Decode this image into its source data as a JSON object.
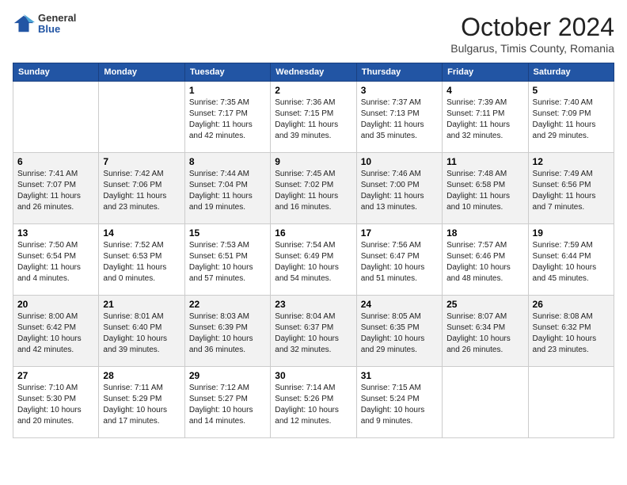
{
  "header": {
    "logo_general": "General",
    "logo_blue": "Blue",
    "month_title": "October 2024",
    "subtitle": "Bulgarus, Timis County, Romania"
  },
  "weekdays": [
    "Sunday",
    "Monday",
    "Tuesday",
    "Wednesday",
    "Thursday",
    "Friday",
    "Saturday"
  ],
  "weeks": [
    [
      {
        "day": "",
        "info": ""
      },
      {
        "day": "",
        "info": ""
      },
      {
        "day": "1",
        "info": "Sunrise: 7:35 AM\nSunset: 7:17 PM\nDaylight: 11 hours and 42 minutes."
      },
      {
        "day": "2",
        "info": "Sunrise: 7:36 AM\nSunset: 7:15 PM\nDaylight: 11 hours and 39 minutes."
      },
      {
        "day": "3",
        "info": "Sunrise: 7:37 AM\nSunset: 7:13 PM\nDaylight: 11 hours and 35 minutes."
      },
      {
        "day": "4",
        "info": "Sunrise: 7:39 AM\nSunset: 7:11 PM\nDaylight: 11 hours and 32 minutes."
      },
      {
        "day": "5",
        "info": "Sunrise: 7:40 AM\nSunset: 7:09 PM\nDaylight: 11 hours and 29 minutes."
      }
    ],
    [
      {
        "day": "6",
        "info": "Sunrise: 7:41 AM\nSunset: 7:07 PM\nDaylight: 11 hours and 26 minutes."
      },
      {
        "day": "7",
        "info": "Sunrise: 7:42 AM\nSunset: 7:06 PM\nDaylight: 11 hours and 23 minutes."
      },
      {
        "day": "8",
        "info": "Sunrise: 7:44 AM\nSunset: 7:04 PM\nDaylight: 11 hours and 19 minutes."
      },
      {
        "day": "9",
        "info": "Sunrise: 7:45 AM\nSunset: 7:02 PM\nDaylight: 11 hours and 16 minutes."
      },
      {
        "day": "10",
        "info": "Sunrise: 7:46 AM\nSunset: 7:00 PM\nDaylight: 11 hours and 13 minutes."
      },
      {
        "day": "11",
        "info": "Sunrise: 7:48 AM\nSunset: 6:58 PM\nDaylight: 11 hours and 10 minutes."
      },
      {
        "day": "12",
        "info": "Sunrise: 7:49 AM\nSunset: 6:56 PM\nDaylight: 11 hours and 7 minutes."
      }
    ],
    [
      {
        "day": "13",
        "info": "Sunrise: 7:50 AM\nSunset: 6:54 PM\nDaylight: 11 hours and 4 minutes."
      },
      {
        "day": "14",
        "info": "Sunrise: 7:52 AM\nSunset: 6:53 PM\nDaylight: 11 hours and 0 minutes."
      },
      {
        "day": "15",
        "info": "Sunrise: 7:53 AM\nSunset: 6:51 PM\nDaylight: 10 hours and 57 minutes."
      },
      {
        "day": "16",
        "info": "Sunrise: 7:54 AM\nSunset: 6:49 PM\nDaylight: 10 hours and 54 minutes."
      },
      {
        "day": "17",
        "info": "Sunrise: 7:56 AM\nSunset: 6:47 PM\nDaylight: 10 hours and 51 minutes."
      },
      {
        "day": "18",
        "info": "Sunrise: 7:57 AM\nSunset: 6:46 PM\nDaylight: 10 hours and 48 minutes."
      },
      {
        "day": "19",
        "info": "Sunrise: 7:59 AM\nSunset: 6:44 PM\nDaylight: 10 hours and 45 minutes."
      }
    ],
    [
      {
        "day": "20",
        "info": "Sunrise: 8:00 AM\nSunset: 6:42 PM\nDaylight: 10 hours and 42 minutes."
      },
      {
        "day": "21",
        "info": "Sunrise: 8:01 AM\nSunset: 6:40 PM\nDaylight: 10 hours and 39 minutes."
      },
      {
        "day": "22",
        "info": "Sunrise: 8:03 AM\nSunset: 6:39 PM\nDaylight: 10 hours and 36 minutes."
      },
      {
        "day": "23",
        "info": "Sunrise: 8:04 AM\nSunset: 6:37 PM\nDaylight: 10 hours and 32 minutes."
      },
      {
        "day": "24",
        "info": "Sunrise: 8:05 AM\nSunset: 6:35 PM\nDaylight: 10 hours and 29 minutes."
      },
      {
        "day": "25",
        "info": "Sunrise: 8:07 AM\nSunset: 6:34 PM\nDaylight: 10 hours and 26 minutes."
      },
      {
        "day": "26",
        "info": "Sunrise: 8:08 AM\nSunset: 6:32 PM\nDaylight: 10 hours and 23 minutes."
      }
    ],
    [
      {
        "day": "27",
        "info": "Sunrise: 7:10 AM\nSunset: 5:30 PM\nDaylight: 10 hours and 20 minutes."
      },
      {
        "day": "28",
        "info": "Sunrise: 7:11 AM\nSunset: 5:29 PM\nDaylight: 10 hours and 17 minutes."
      },
      {
        "day": "29",
        "info": "Sunrise: 7:12 AM\nSunset: 5:27 PM\nDaylight: 10 hours and 14 minutes."
      },
      {
        "day": "30",
        "info": "Sunrise: 7:14 AM\nSunset: 5:26 PM\nDaylight: 10 hours and 12 minutes."
      },
      {
        "day": "31",
        "info": "Sunrise: 7:15 AM\nSunset: 5:24 PM\nDaylight: 10 hours and 9 minutes."
      },
      {
        "day": "",
        "info": ""
      },
      {
        "day": "",
        "info": ""
      }
    ]
  ]
}
